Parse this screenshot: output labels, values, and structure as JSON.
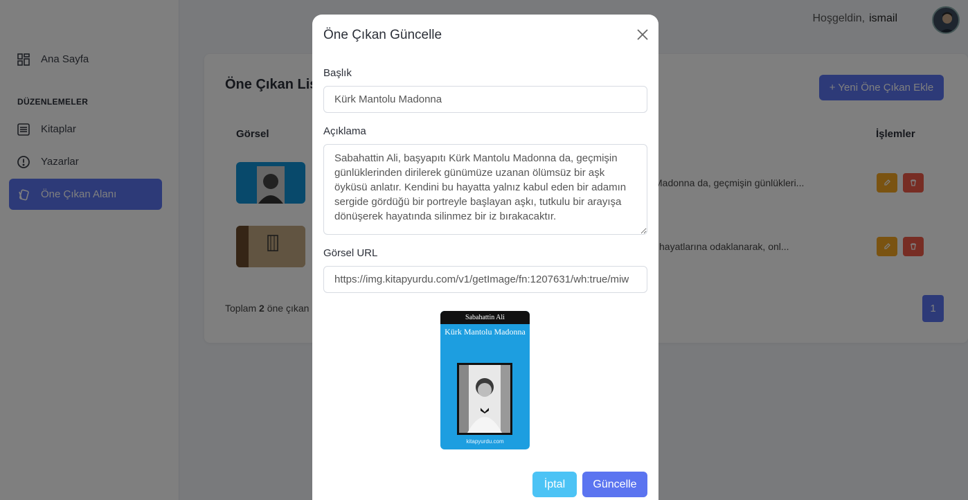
{
  "header": {
    "greeting": "Hoşgeldin,",
    "username": "ismail"
  },
  "sidebar": {
    "items": [
      {
        "label": "Ana Sayfa",
        "icon": "dashboard-icon"
      },
      {
        "label": "Kitaplar",
        "icon": "list-icon"
      },
      {
        "label": "Yazarlar",
        "icon": "alert-circle-icon"
      },
      {
        "label": "Öne Çıkan Alanı",
        "icon": "cards-icon",
        "active": true
      }
    ],
    "section_title": "DÜZENLEMELER"
  },
  "main": {
    "title": "Öne Çıkan Liste",
    "add_button": "+ Yeni Öne Çıkan Ekle",
    "columns": {
      "image": "Görsel",
      "actions": "İşlemler"
    },
    "rows": [
      {
        "description": "Madonna da, geçmişin günlükleri..."
      },
      {
        "description": "hayatlarına odaklanarak, onl..."
      }
    ],
    "total_prefix": "Toplam",
    "total_count": "2",
    "total_suffix": "öne çıkan",
    "page": "1"
  },
  "modal": {
    "title": "Öne Çıkan Güncelle",
    "title_label": "Başlık",
    "title_value": "Kürk Mantolu Madonna",
    "description_label": "Açıklama",
    "description_value": "Sabahattin Ali, başyapıtı Kürk Mantolu Madonna da, geçmişin günlüklerinden dirilerek günümüze uzanan ölümsüz bir aşk öyküsü anlatır. Kendini bu hayatta yalnız kabul eden bir adamın sergide gördüğü bir portreyle başlayan aşkı, tutkulu bir arayışa dönüşerek hayatında silinmez bir iz bırakacaktır.",
    "url_label": "Görsel URL",
    "url_value": "https://img.kitapyurdu.com/v1/getImage/fn:1207631/wh:true/miw",
    "preview": {
      "author": "Sabahattin Ali",
      "title": "Kürk Mantolu Madonna",
      "site": "kitapyurdu.com"
    },
    "cancel_label": "İptal",
    "update_label": "Güncelle"
  },
  "colors": {
    "primary": "#5b74f0",
    "cancel": "#4cc3f5",
    "edit": "#f5a623",
    "delete": "#ef5a48"
  }
}
